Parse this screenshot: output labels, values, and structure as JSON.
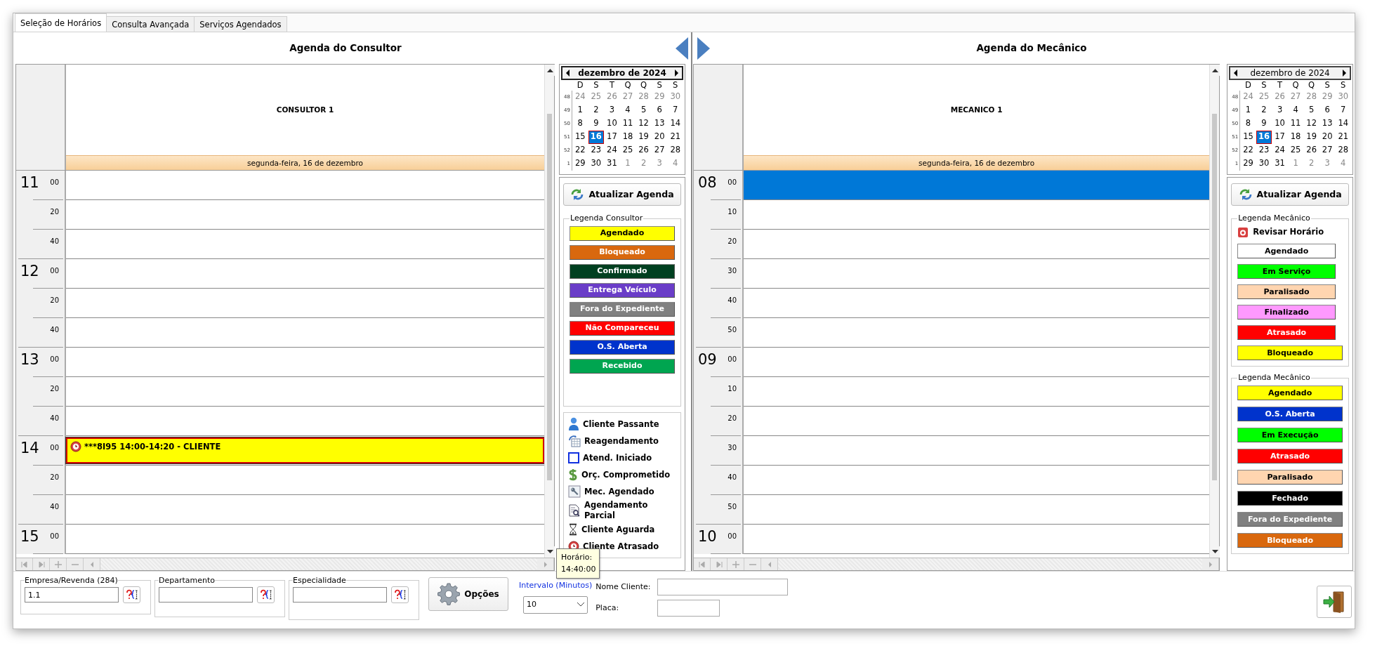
{
  "tabs": [
    {
      "label": "Seleção de Horários",
      "selected": true
    },
    {
      "label": "Consulta Avançada",
      "selected": false
    },
    {
      "label": "Serviços Agendados",
      "selected": false
    }
  ],
  "consultant": {
    "title": "Agenda do Consultor",
    "column": "CONSULTOR 1",
    "date": "segunda-feira, 16 de dezembro",
    "rows": [
      {
        "hour": "11",
        "minute": "00",
        "selected": false
      },
      {
        "minute": "20",
        "selected": false
      },
      {
        "minute": "40",
        "selected": false
      },
      {
        "hour": "12",
        "minute": "00",
        "selected": false
      },
      {
        "minute": "20",
        "selected": false
      },
      {
        "minute": "40",
        "selected": false
      },
      {
        "hour": "13",
        "minute": "00",
        "selected": false
      },
      {
        "minute": "20",
        "selected": false
      },
      {
        "minute": "40",
        "selected": false
      },
      {
        "hour": "14",
        "minute": "00",
        "selected": false,
        "appointment": {
          "text": "***8I95 14:00-14:20 - CLIENTE",
          "color": "#ffff00"
        }
      },
      {
        "minute": "20",
        "selected": false
      },
      {
        "minute": "40",
        "selected": false
      },
      {
        "hour": "15",
        "minute": "00",
        "selected": false
      }
    ],
    "calendar": {
      "month": "dezembro de 2024",
      "focused": true,
      "weekdays": [
        "D",
        "S",
        "T",
        "Q",
        "Q",
        "S",
        "S"
      ],
      "weeks": [
        {
          "number": "48",
          "days": [
            {
              "day": "24",
              "muted": true,
              "selected": false
            },
            {
              "day": "25",
              "muted": true,
              "selected": false
            },
            {
              "day": "26",
              "muted": true,
              "selected": false
            },
            {
              "day": "27",
              "muted": true,
              "selected": false
            },
            {
              "day": "28",
              "muted": true,
              "selected": false
            },
            {
              "day": "29",
              "muted": true,
              "selected": false
            },
            {
              "day": "30",
              "muted": true,
              "selected": false
            }
          ]
        },
        {
          "number": "49",
          "days": [
            {
              "day": "1",
              "muted": false,
              "selected": false
            },
            {
              "day": "2",
              "muted": false,
              "selected": false
            },
            {
              "day": "3",
              "muted": false,
              "selected": false
            },
            {
              "day": "4",
              "muted": false,
              "selected": false
            },
            {
              "day": "5",
              "muted": false,
              "selected": false
            },
            {
              "day": "6",
              "muted": false,
              "selected": false
            },
            {
              "day": "7",
              "muted": false,
              "selected": false
            }
          ]
        },
        {
          "number": "50",
          "days": [
            {
              "day": "8",
              "muted": false,
              "selected": false
            },
            {
              "day": "9",
              "muted": false,
              "selected": false
            },
            {
              "day": "10",
              "muted": false,
              "selected": false
            },
            {
              "day": "11",
              "muted": false,
              "selected": false
            },
            {
              "day": "12",
              "muted": false,
              "selected": false
            },
            {
              "day": "13",
              "muted": false,
              "selected": false
            },
            {
              "day": "14",
              "muted": false,
              "selected": false
            }
          ]
        },
        {
          "number": "51",
          "days": [
            {
              "day": "15",
              "muted": false,
              "selected": false
            },
            {
              "day": "16",
              "muted": false,
              "selected": true
            },
            {
              "day": "17",
              "muted": false,
              "selected": false
            },
            {
              "day": "18",
              "muted": false,
              "selected": false
            },
            {
              "day": "19",
              "muted": false,
              "selected": false
            },
            {
              "day": "20",
              "muted": false,
              "selected": false
            },
            {
              "day": "21",
              "muted": false,
              "selected": false
            }
          ]
        },
        {
          "number": "52",
          "days": [
            {
              "day": "22",
              "muted": false,
              "selected": false
            },
            {
              "day": "23",
              "muted": false,
              "selected": false
            },
            {
              "day": "24",
              "muted": false,
              "selected": false
            },
            {
              "day": "25",
              "muted": false,
              "selected": false
            },
            {
              "day": "26",
              "muted": false,
              "selected": false
            },
            {
              "day": "27",
              "muted": false,
              "selected": false
            },
            {
              "day": "28",
              "muted": false,
              "selected": false
            }
          ]
        },
        {
          "number": "1",
          "days": [
            {
              "day": "29",
              "muted": false,
              "selected": false
            },
            {
              "day": "30",
              "muted": false,
              "selected": false
            },
            {
              "day": "31",
              "muted": false,
              "selected": false
            },
            {
              "day": "1",
              "muted": true,
              "selected": false
            },
            {
              "day": "2",
              "muted": true,
              "selected": false
            },
            {
              "day": "3",
              "muted": true,
              "selected": false
            },
            {
              "day": "4",
              "muted": true,
              "selected": false
            }
          ]
        }
      ]
    },
    "refresh_button": "Atualizar Agenda",
    "legends": [
      {
        "title": "Legenda Consultor",
        "items": [
          {
            "kind": "swatch",
            "label": "Agendado",
            "color": "#ffff00"
          },
          {
            "kind": "swatch",
            "label": "Bloqueado",
            "color": "#d9680e"
          },
          {
            "kind": "swatch",
            "label": "Confirmado",
            "color": "#004020"
          },
          {
            "kind": "swatch",
            "label": "Entrega Veículo",
            "color": "#6a3dc8"
          },
          {
            "kind": "swatch",
            "label": "Fora do Expediente",
            "color": "#808080"
          },
          {
            "kind": "swatch",
            "label": "Não Compareceu",
            "color": "#ff0000"
          },
          {
            "kind": "swatch",
            "label": "O.S. Aberta",
            "color": "#0033cc"
          },
          {
            "kind": "swatch",
            "label": "Recebido",
            "color": "#00a550"
          }
        ]
      }
    ],
    "icon_legend": [
      {
        "kind": "person",
        "label": "Cliente Passante"
      },
      {
        "kind": "reschedule",
        "label": "Reagendamento"
      },
      {
        "kind": "square",
        "label": "Atend. Iniciado"
      },
      {
        "kind": "dollar",
        "label": "Orç. Comprometido"
      },
      {
        "kind": "wrench",
        "label": "Mec. Agendado"
      },
      {
        "kind": "document",
        "label": "Agendamento Parcial"
      },
      {
        "kind": "hourglass",
        "label": "Cliente Aguarda"
      },
      {
        "kind": "clock",
        "label": "Cliente Atrasado"
      }
    ]
  },
  "mechanic": {
    "title": "Agenda do Mecânico",
    "column": "MECANICO 1",
    "date": "segunda-feira, 16 de dezembro",
    "rows": [
      {
        "hour": "08",
        "minute": "00",
        "selected": true
      },
      {
        "minute": "10",
        "selected": false
      },
      {
        "minute": "20",
        "selected": false
      },
      {
        "minute": "30",
        "selected": false
      },
      {
        "minute": "40",
        "selected": false
      },
      {
        "minute": "50",
        "selected": false
      },
      {
        "hour": "09",
        "minute": "00",
        "selected": false
      },
      {
        "minute": "10",
        "selected": false
      },
      {
        "minute": "20",
        "selected": false
      },
      {
        "minute": "30",
        "selected": false
      },
      {
        "minute": "40",
        "selected": false
      },
      {
        "minute": "50",
        "selected": false
      },
      {
        "hour": "10",
        "minute": "00",
        "selected": false
      }
    ],
    "calendar": {
      "month": "dezembro de 2024",
      "focused": false,
      "weekdays": [
        "D",
        "S",
        "T",
        "Q",
        "Q",
        "S",
        "S"
      ],
      "weeks": [
        {
          "number": "48",
          "days": [
            {
              "day": "24",
              "muted": true,
              "selected": false
            },
            {
              "day": "25",
              "muted": true,
              "selected": false
            },
            {
              "day": "26",
              "muted": true,
              "selected": false
            },
            {
              "day": "27",
              "muted": true,
              "selected": false
            },
            {
              "day": "28",
              "muted": true,
              "selected": false
            },
            {
              "day": "29",
              "muted": true,
              "selected": false
            },
            {
              "day": "30",
              "muted": true,
              "selected": false
            }
          ]
        },
        {
          "number": "49",
          "days": [
            {
              "day": "1",
              "muted": false,
              "selected": false
            },
            {
              "day": "2",
              "muted": false,
              "selected": false
            },
            {
              "day": "3",
              "muted": false,
              "selected": false
            },
            {
              "day": "4",
              "muted": false,
              "selected": false
            },
            {
              "day": "5",
              "muted": false,
              "selected": false
            },
            {
              "day": "6",
              "muted": false,
              "selected": false
            },
            {
              "day": "7",
              "muted": false,
              "selected": false
            }
          ]
        },
        {
          "number": "50",
          "days": [
            {
              "day": "8",
              "muted": false,
              "selected": false
            },
            {
              "day": "9",
              "muted": false,
              "selected": false
            },
            {
              "day": "10",
              "muted": false,
              "selected": false
            },
            {
              "day": "11",
              "muted": false,
              "selected": false
            },
            {
              "day": "12",
              "muted": false,
              "selected": false
            },
            {
              "day": "13",
              "muted": false,
              "selected": false
            },
            {
              "day": "14",
              "muted": false,
              "selected": false
            }
          ]
        },
        {
          "number": "51",
          "days": [
            {
              "day": "15",
              "muted": false,
              "selected": false
            },
            {
              "day": "16",
              "muted": false,
              "selected": true
            },
            {
              "day": "17",
              "muted": false,
              "selected": false
            },
            {
              "day": "18",
              "muted": false,
              "selected": false
            },
            {
              "day": "19",
              "muted": false,
              "selected": false
            },
            {
              "day": "20",
              "muted": false,
              "selected": false
            },
            {
              "day": "21",
              "muted": false,
              "selected": false
            }
          ]
        },
        {
          "number": "52",
          "days": [
            {
              "day": "22",
              "muted": false,
              "selected": false
            },
            {
              "day": "23",
              "muted": false,
              "selected": false
            },
            {
              "day": "24",
              "muted": false,
              "selected": false
            },
            {
              "day": "25",
              "muted": false,
              "selected": false
            },
            {
              "day": "26",
              "muted": false,
              "selected": false
            },
            {
              "day": "27",
              "muted": false,
              "selected": false
            },
            {
              "day": "28",
              "muted": false,
              "selected": false
            }
          ]
        },
        {
          "number": "1",
          "days": [
            {
              "day": "29",
              "muted": false,
              "selected": false
            },
            {
              "day": "30",
              "muted": false,
              "selected": false
            },
            {
              "day": "31",
              "muted": false,
              "selected": false
            },
            {
              "day": "1",
              "muted": true,
              "selected": false
            },
            {
              "day": "2",
              "muted": true,
              "selected": false
            },
            {
              "day": "3",
              "muted": true,
              "selected": false
            },
            {
              "day": "4",
              "muted": true,
              "selected": false
            }
          ]
        }
      ]
    },
    "refresh_button": "Atualizar Agenda",
    "legends": [
      {
        "title": "Legenda Mecânico",
        "items": [
          {
            "kind": "icon",
            "label": "Revisar Horário"
          },
          {
            "kind": "swatch",
            "label": "Agendado",
            "color": "#ffffff"
          },
          {
            "kind": "swatch",
            "label": "Em Serviço",
            "color": "#00ff00"
          },
          {
            "kind": "swatch",
            "label": "Paralisado",
            "color": "#ffd5b0"
          },
          {
            "kind": "swatch",
            "label": "Finalizado",
            "color": "#ff99ff"
          },
          {
            "kind": "swatch",
            "label": "Atrasado",
            "color": "#ff0000"
          },
          {
            "kind": "swatch",
            "label": "Bloqueado",
            "color": "#ffff00"
          }
        ]
      },
      {
        "title": "Legenda Mecânico",
        "items": [
          {
            "kind": "swatch",
            "label": "Agendado",
            "color": "#ffff00"
          },
          {
            "kind": "swatch",
            "label": "O.S. Aberta",
            "color": "#0033cc"
          },
          {
            "kind": "swatch",
            "label": "Em Execução",
            "color": "#00ff00"
          },
          {
            "kind": "swatch",
            "label": "Atrasado",
            "color": "#ff0000"
          },
          {
            "kind": "swatch",
            "label": "Paralisado",
            "color": "#ffd5b0"
          },
          {
            "kind": "swatch",
            "label": "Fechado",
            "color": "#000000"
          },
          {
            "kind": "swatch",
            "label": "Fora do Expediente",
            "color": "#808080"
          },
          {
            "kind": "swatch",
            "label": "Bloqueado",
            "color": "#d9680e"
          }
        ]
      }
    ]
  },
  "filters": [
    {
      "label": "Empresa/Revenda (284)",
      "value": "1.1"
    },
    {
      "label": "Departamento"
    },
    {
      "label": "Especialidade"
    }
  ],
  "options_button": "Opções",
  "interval": {
    "label": "Intervalo (Minutos)",
    "value": "10"
  },
  "client_name": {
    "label": "Nome Cliente:"
  },
  "plate": {
    "label": "Placa:"
  },
  "tooltip": [
    "Horário:",
    "14:40:00"
  ]
}
